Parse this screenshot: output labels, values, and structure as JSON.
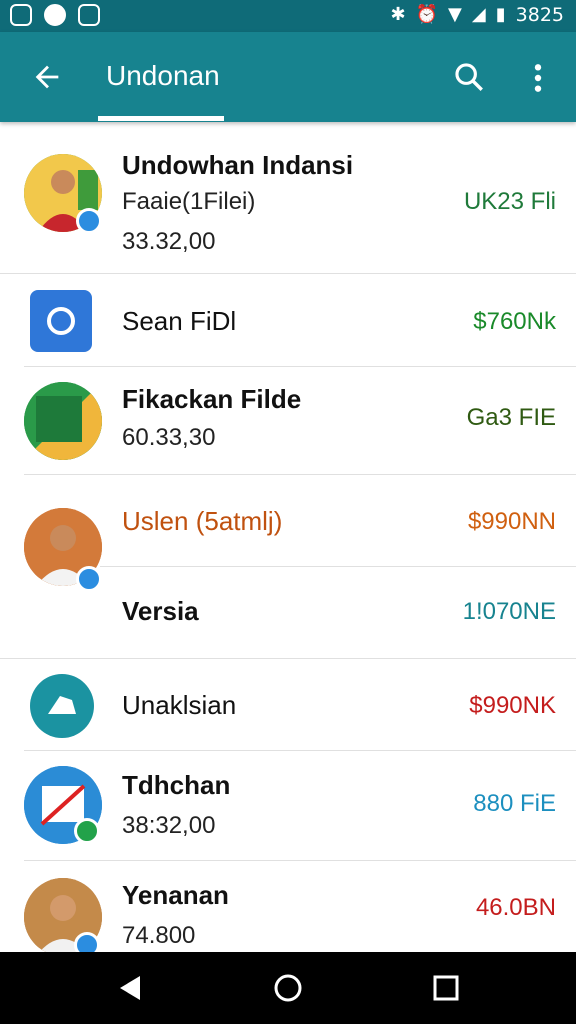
{
  "status_bar": {
    "time": "3825",
    "icons": [
      "screenshot-icon",
      "cat-icon",
      "image-icon",
      "vibrate-icon",
      "alarm-icon",
      "wifi-icon",
      "signal-icon",
      "battery-icon"
    ]
  },
  "app_bar": {
    "title": "Undonan",
    "back_icon": "arrow-left-icon",
    "search_icon": "search-icon",
    "more_icon": "more-vert-icon",
    "color": "#17838f"
  },
  "items": [
    {
      "title": "Undowhan Indansi",
      "subtitle": "Faaie(1Filei)",
      "detail": "33.32,00",
      "price": "UK23 Fli",
      "price_color": "#1f7a3a",
      "avatar": "person-avatar",
      "badge": "check-badge"
    },
    {
      "title": "Sean FiDl",
      "price": "$760Nk",
      "price_color": "#1a8a2a",
      "avatar": "camera-app-icon"
    },
    {
      "title": "Fikackan Filde",
      "detail": "60.33,30",
      "price": "Ga3 FIE",
      "price_color": "#2f5a12",
      "avatar": "document-app-icon"
    },
    {
      "title": "Uslen (5atmlj)",
      "price": "$990NN",
      "price_color": "#d06010",
      "title_color": "#c0510f",
      "avatar": "person-avatar",
      "badge": "share-badge"
    },
    {
      "title": "Versia",
      "price": "1!070NE",
      "price_color": "#17838f"
    },
    {
      "title": "Unaklsian",
      "price": "$990NK",
      "price_color": "#c41d1d",
      "avatar": "puzzle-app-icon"
    },
    {
      "title": "Tdhchan",
      "detail": "38:32,00",
      "price": "880 FiE",
      "price_color": "#1c8fbf",
      "avatar": "image-app-icon",
      "badge": "check-badge"
    },
    {
      "title": "Yenanan",
      "detail": "74.800",
      "price": "46.0BN",
      "price_color": "#c41d1d",
      "avatar": "person-avatar",
      "badge": "bolt-badge"
    }
  ],
  "nav_bar": {
    "icons": [
      "back-triangle-icon",
      "home-circle-icon",
      "recents-square-icon"
    ]
  }
}
